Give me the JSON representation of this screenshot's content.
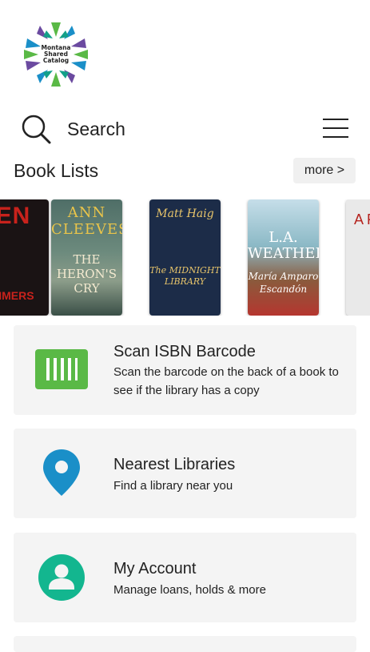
{
  "logo": {
    "line1": "Montana",
    "line2": "Shared",
    "line3": "Catalog"
  },
  "search": {
    "label": "Search"
  },
  "book_lists": {
    "title": "Book Lists",
    "more_label": "more >",
    "books": [
      {
        "author": "EN",
        "title": "MMERS"
      },
      {
        "author": "ANN CLEEVES",
        "title": "THE HERON'S CRY"
      },
      {
        "author": "Matt Haig",
        "title": "The MIDNIGHT LIBRARY"
      },
      {
        "author": "María Amparo Escandón",
        "title": "L.A. WEATHER"
      },
      {
        "author": "A FE",
        "title": ""
      }
    ]
  },
  "actions": [
    {
      "title": "Scan ISBN Barcode",
      "subtitle": "Scan the barcode on the back of a book to see if the library has a copy",
      "icon": "barcode-icon"
    },
    {
      "title": "Nearest Libraries",
      "subtitle": "Find a library near you",
      "icon": "location-pin-icon"
    },
    {
      "title": "My Account",
      "subtitle": "Manage loans, holds & more",
      "icon": "account-icon"
    }
  ],
  "colors": {
    "green": "#5ab946",
    "blue": "#1a8fc8",
    "teal": "#13b68f",
    "card_bg": "#f4f4f4"
  }
}
